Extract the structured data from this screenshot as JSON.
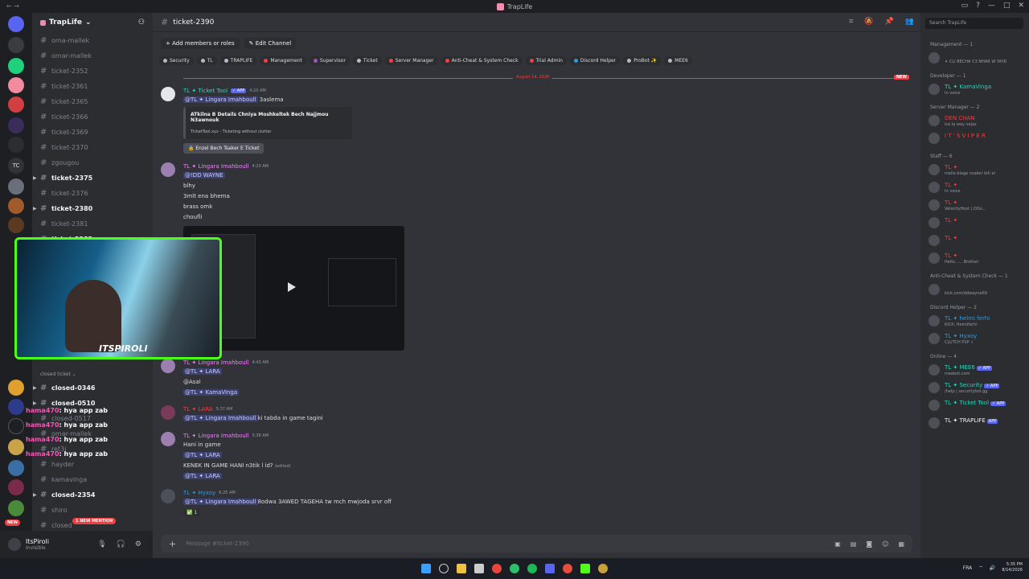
{
  "window": {
    "title": "TrapLife",
    "search_placeholder": "Search TrapLife"
  },
  "guild": {
    "name": "TrapLife"
  },
  "server_tc_label": "TC",
  "channels": [
    {
      "label": "oma-mallek",
      "unread": false
    },
    {
      "label": "omar-mallek",
      "unread": false
    },
    {
      "label": "ticket-2352",
      "unread": false
    },
    {
      "label": "ticket-2361",
      "unread": false
    },
    {
      "label": "ticket-2365",
      "unread": false
    },
    {
      "label": "ticket-2366",
      "unread": false
    },
    {
      "label": "ticket-2369",
      "unread": false
    },
    {
      "label": "ticket-2370",
      "unread": false
    },
    {
      "label": "zgougou",
      "unread": false
    },
    {
      "label": "ticket-2375",
      "unread": true
    },
    {
      "label": "ticket-2376",
      "unread": false
    },
    {
      "label": "ticket-2380",
      "unread": true
    },
    {
      "label": "ticket-2381",
      "unread": false
    },
    {
      "label": "ticket-2382",
      "unread": true
    }
  ],
  "closed_category": "closed ticket",
  "closed_channels": [
    {
      "label": "closed-0346",
      "unread": true
    },
    {
      "label": "closed-0510",
      "unread": true
    },
    {
      "label": "closed-0517",
      "unread": false
    },
    {
      "label": "omar-mallek",
      "unread": false
    },
    {
      "label": "ret3i",
      "unread": false
    },
    {
      "label": "hayder",
      "unread": false
    },
    {
      "label": "kamavinga",
      "unread": false
    },
    {
      "label": "closed-2354",
      "unread": true
    },
    {
      "label": "shiro",
      "unread": false
    },
    {
      "label": "closed",
      "unread": false
    }
  ],
  "new_mention": "1 NEW MENTION",
  "new_badge": "NEW",
  "user": {
    "name": "ItsPiroli",
    "status": "Invisible"
  },
  "channel": {
    "name": "ticket-2390"
  },
  "actions": {
    "add_members": "Add members or roles",
    "edit_channel": "Edit Channel"
  },
  "tags": [
    {
      "label": "Security",
      "color": "#b5bac1"
    },
    {
      "label": "TL",
      "color": "#b5bac1"
    },
    {
      "label": "TRAPLIFE",
      "color": "#b5bac1"
    },
    {
      "label": "Management",
      "color": "#f23f43"
    },
    {
      "label": "Supervisor",
      "color": "#9b59b6"
    },
    {
      "label": "Ticket",
      "color": "#b5bac1"
    },
    {
      "label": "Server Manager",
      "color": "#f23f43"
    },
    {
      "label": "Anti-Cheat & System Check",
      "color": "#f23f43"
    },
    {
      "label": "Trial Admin",
      "color": "#f23f43"
    },
    {
      "label": "Discord Helper",
      "color": "#3498db"
    },
    {
      "label": "ProBot ✨",
      "color": "#b5bac1"
    },
    {
      "label": "MEE6",
      "color": "#b5bac1"
    }
  ],
  "divider": {
    "date": "August 14, 2026",
    "new": "NEW"
  },
  "messages": {
    "m1": {
      "author": "TL ✦ Ticket Tool",
      "app": "✓ APP",
      "time": "4:20 AM",
      "mention": "@TL ✦ Lingara Imahboull",
      "text": "3aslema",
      "embed_title": "ATkilna B Details Chniya Moshkeltek Bech Najjmou N3awnouk",
      "embed_footer": "TicketTool.xyz - Ticketing without clutter",
      "button": "🔒 Enzel Bech Tsaker E Ticket"
    },
    "m2": {
      "author": "TL ✦ Lingara Imahboull",
      "time": "4:20 AM",
      "lines": [
        "@!DD WAYNE",
        "blhy",
        "3mlt ena bhema",
        "brass omk",
        "choufli"
      ]
    },
    "m3": {
      "author": "TL ✦ Lingara Imahboull",
      "time": "4:43 AM",
      "lines": [
        "@TL ✦ LARA",
        "@Asal",
        "@TL ✦ KamaVinga"
      ]
    },
    "m4": {
      "author": "TL ✦ LARA",
      "time": "5:37 AM",
      "mention": "@TL ✦ Lingara Imahboull",
      "text": "ki tabda in game tagini"
    },
    "m5": {
      "author": "TL ✦ Lingara Imahboull",
      "time": "5:38 AM",
      "lines": [
        "Hani in game",
        "@TL ✦ LARA",
        "KENEK IN GAME HANI n3tik l id?",
        "@TL ✦ LARA"
      ],
      "edited": "(edited)"
    },
    "m6": {
      "author": "TL ✦ Hyxoy",
      "time": "6:25 AM",
      "mention": "@TL ✦ Lingara Imahboull",
      "text": "8odwa 3AWED TAGEHA tw mch mwjoda srvr off",
      "reaction": "✅ 1"
    }
  },
  "composer_placeholder": "Message #ticket-2390",
  "members": {
    "groups": [
      {
        "title": "Management — 1",
        "list": [
          {
            "name": "",
            "sub": "✦ CLI BECHA Y.3 NHAR W YAYR",
            "color": "#f23f43"
          }
        ]
      },
      {
        "title": "Developer — 1",
        "list": [
          {
            "name": "TL ✦ KamaVinga",
            "sub": "In voice",
            "color": "#2dd4bf"
          }
        ]
      },
      {
        "title": "Server Manager — 2",
        "list": [
          {
            "name": "DEN CHAN",
            "sub": "ice la way vejas",
            "color": "#f23f43"
          },
          {
            "name": "I T ' S  V I P E R",
            "sub": "",
            "color": "#f23f43"
          }
        ]
      },
      {
        "title": "Staff — 6",
        "list": [
          {
            "name": "TL ✦",
            "sub": "mella blage nsaker bih el",
            "color": "#f23f43"
          },
          {
            "name": "TL ✦",
            "sub": "In voice",
            "color": "#f23f43"
          },
          {
            "name": "TL ✦",
            "sub": "VelocityHost | DDo...",
            "color": "#f23f43"
          },
          {
            "name": "TL ✦",
            "sub": "",
            "color": "#f23f43"
          },
          {
            "name": "TL ✦",
            "sub": "",
            "color": "#f23f43"
          },
          {
            "name": "TL ✦",
            "sub": "Hello...... Brother",
            "color": "#f23f43"
          }
        ]
      },
      {
        "title": "Anti-Cheat & System Check — 1",
        "list": [
          {
            "name": "",
            "sub": "kick.com/ddwayne69",
            "color": "#f23f43"
          }
        ]
      },
      {
        "title": "Discord Helper — 2",
        "list": [
          {
            "name": "TL ✦ helmi ferhi",
            "sub": "KICK: Helmiferhi",
            "color": "#3498db"
          },
          {
            "name": "TL ✦ Hyxoy",
            "sub": "CLUTCH PVP ⚡",
            "color": "#3498db"
          }
        ]
      },
      {
        "title": "Online — 4",
        "list": [
          {
            "name": "TL ✦ MEE6",
            "sub": "meebot.com",
            "color": "#2dd4bf",
            "app": "✓ APP"
          },
          {
            "name": "TL ✦ Security",
            "sub": "/help | securitybot.gg",
            "color": "#2dd4bf",
            "app": "✓ APP"
          },
          {
            "name": "TL ✦ Ticket Tool",
            "sub": "",
            "color": "#2dd4bf",
            "app": "✓ APP"
          },
          {
            "name": "TL ✦ TRAPLIFE",
            "sub": "",
            "color": "#f2f3f5",
            "app": "APP"
          }
        ]
      }
    ]
  },
  "stream_overlay": {
    "label": "ITSPIROLI",
    "chat": [
      {
        "name": "hama470",
        "text": ": hya app zab"
      },
      {
        "name": "hama470",
        "text": ": hya app zab"
      },
      {
        "name": "hama470",
        "text": ": hya app zab"
      },
      {
        "name": "hama470",
        "text": ": hya app zab"
      }
    ]
  },
  "taskbar": {
    "lang": "FRA",
    "time": "5:35 PM",
    "date": "8/14/2026"
  }
}
